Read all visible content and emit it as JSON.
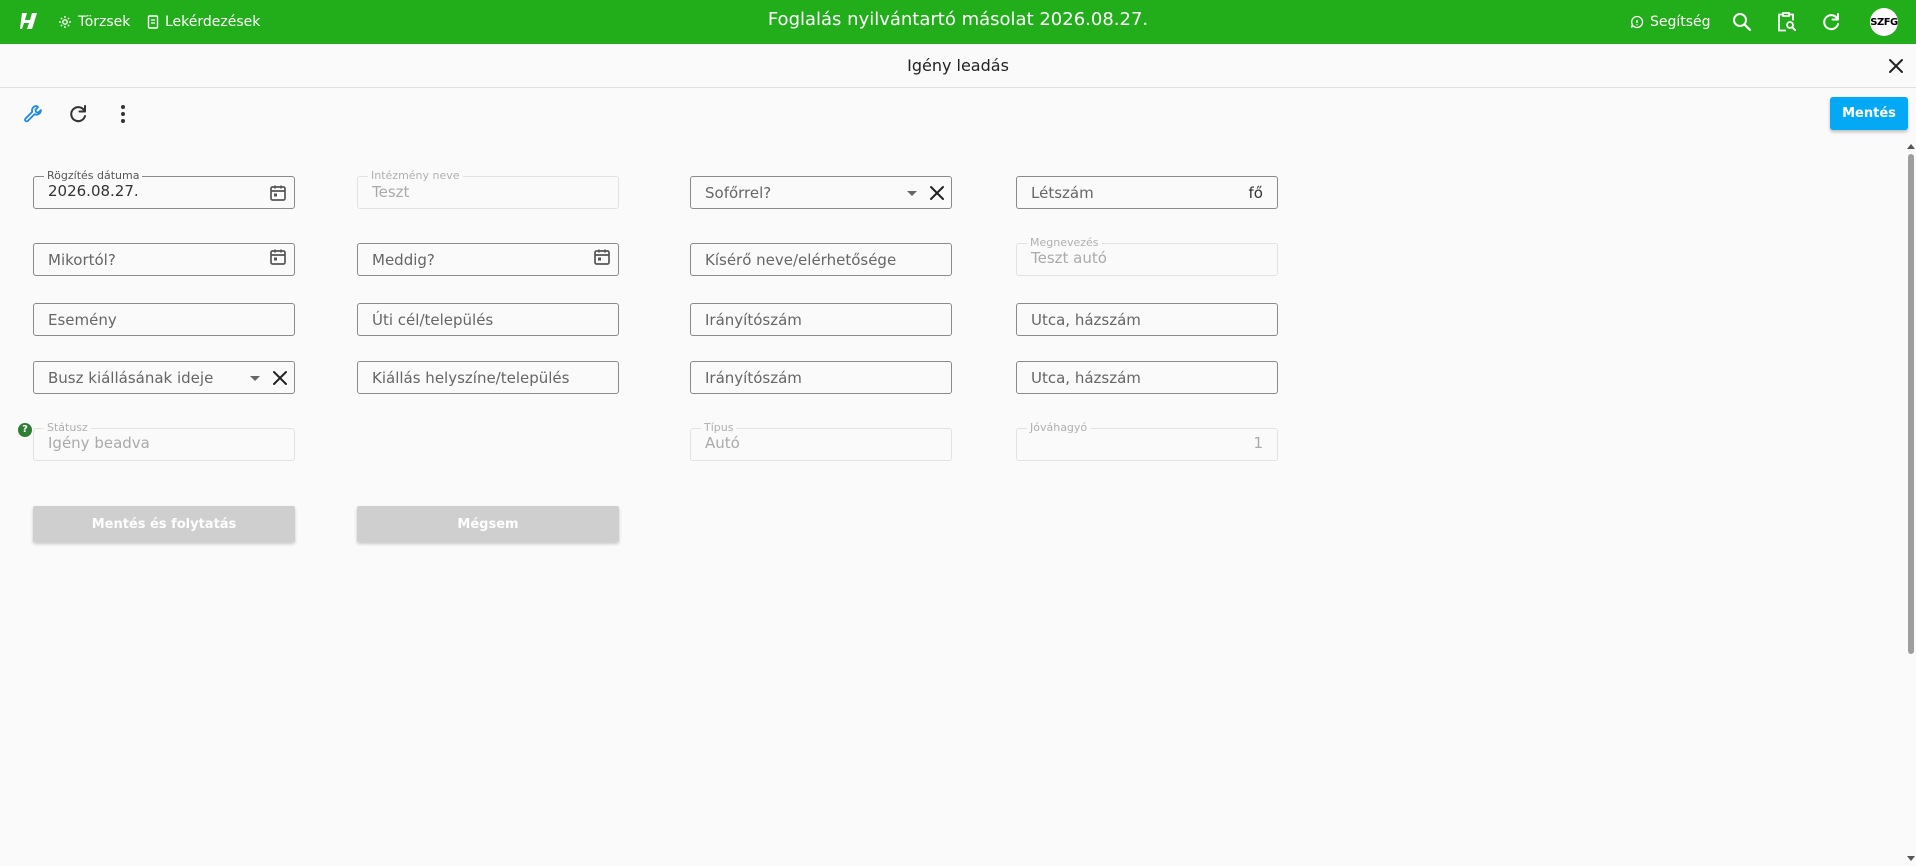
{
  "app": {
    "title": "Foglalás nyilvántartó másolat 2026.08.27.",
    "nav": [
      {
        "label": "Törzsek"
      },
      {
        "label": "Lekérdezések"
      }
    ],
    "help_label": "Segítség",
    "avatar_initials": "SZFG",
    "brand_color": "#22ad1a"
  },
  "dialog": {
    "title": "Igény leadás",
    "save_label": "Mentés",
    "accent_color": "#03a9f4"
  },
  "form": {
    "recording_date": {
      "label": "Rögzítés dátuma",
      "value": "2026.08.27."
    },
    "institution_name": {
      "label": "Intézmény neve",
      "value": "Teszt"
    },
    "with_driver": {
      "placeholder": "Sofőrrel?"
    },
    "headcount": {
      "placeholder": "Létszám",
      "suffix": "fő"
    },
    "from_date": {
      "placeholder": "Mikortól?"
    },
    "to_date": {
      "placeholder": "Meddig?"
    },
    "escort_contact": {
      "placeholder": "Kísérő neve/elérhetősége"
    },
    "vehicle_name": {
      "label": "Megnevezés",
      "value": "Teszt autó"
    },
    "event": {
      "placeholder": "Esemény"
    },
    "destination": {
      "placeholder": "Úti cél/település"
    },
    "dest_zip": {
      "placeholder": "Irányítószám"
    },
    "dest_street": {
      "placeholder": "Utca, házszám"
    },
    "bus_departure_time": {
      "placeholder": "Busz kiállásának ideje"
    },
    "departure_place": {
      "placeholder": "Kiállás helyszíne/település"
    },
    "dep_zip": {
      "placeholder": "Irányítószám"
    },
    "dep_street": {
      "placeholder": "Utca, házszám"
    },
    "status": {
      "label": "Státusz",
      "value": "Igény beadva"
    },
    "type": {
      "label": "Típus",
      "value": "Autó"
    },
    "approver": {
      "label": "Jóváhagyó",
      "value": "1"
    }
  },
  "actions": {
    "save_continue_label": "Mentés és folytatás",
    "cancel_label": "Mégsem"
  }
}
